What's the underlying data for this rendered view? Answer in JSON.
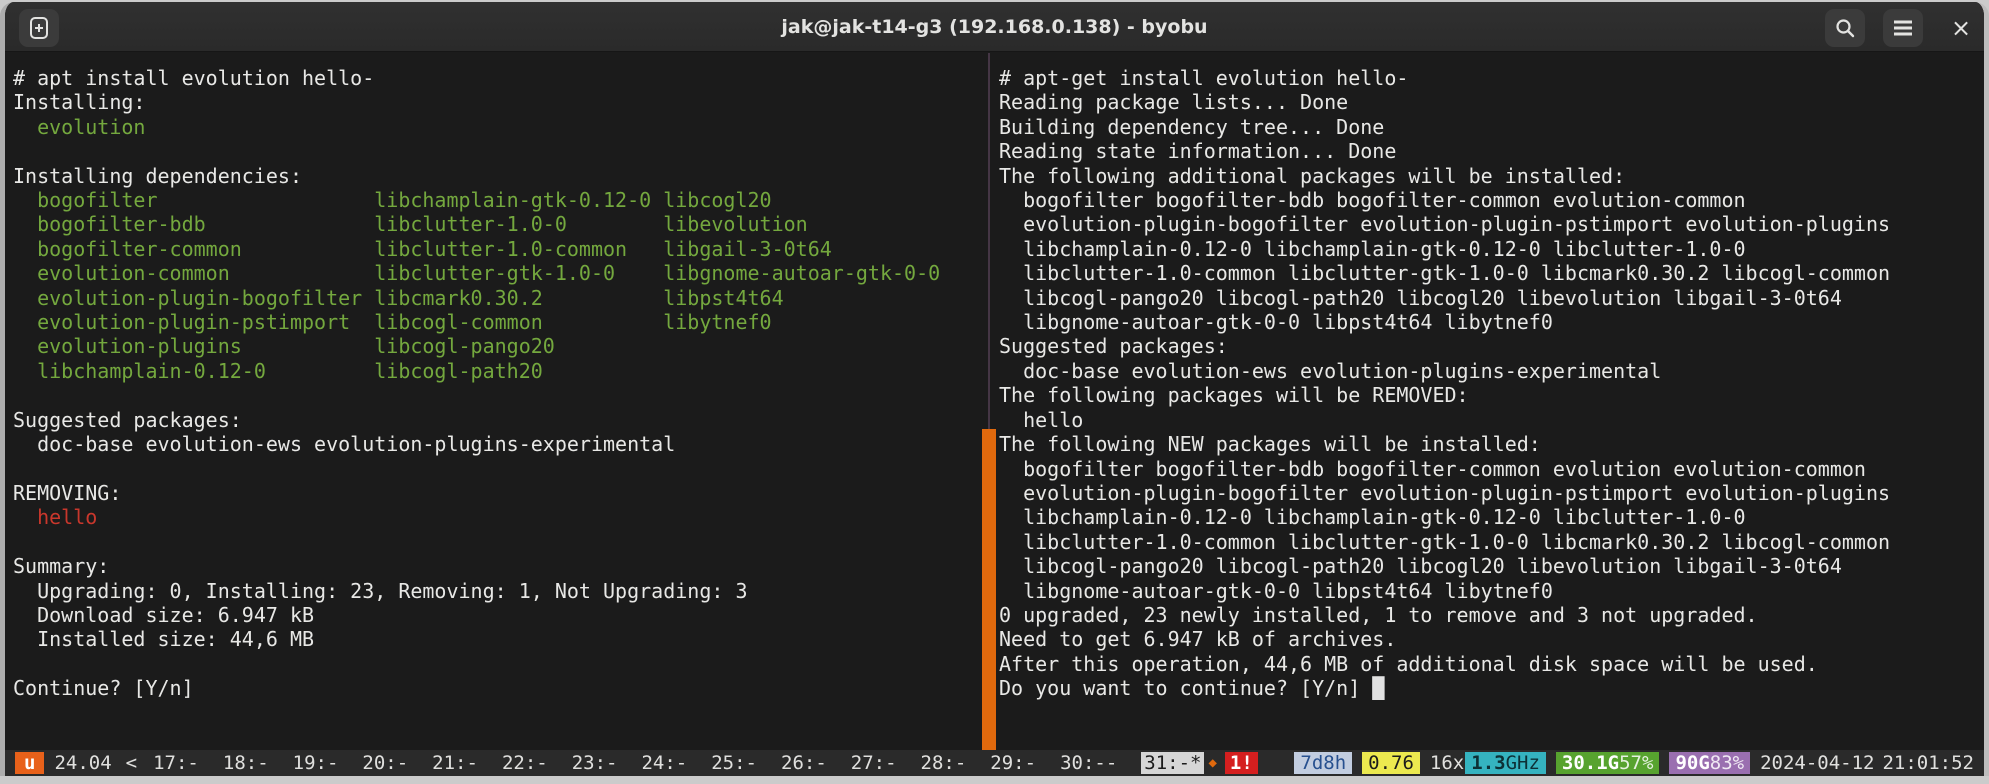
{
  "window": {
    "title": "jak@jak-t14-g3 (192.168.0.138) - byobu"
  },
  "titlebar": {
    "close_glyph": "×"
  },
  "colors": {
    "terminal_bg": "#1b1b1b",
    "titlebar_bg": "#2d2d2d",
    "statusbar_bg": "#2a2a2a",
    "text": "#e8e8e6",
    "green": "#74a83e",
    "red": "#c9372c",
    "active_pane_indicator": "#e0690d",
    "distro_badge": "#e8611a",
    "alert_badge": "#d51f1f",
    "uptime_badge": "#c2cde0",
    "load_badge": "#ece94f",
    "freq_badge": "#35b3c0",
    "mem_badge": "#57a32f",
    "disk_badge": "#9a6fb0"
  },
  "left_pane": {
    "lines": [
      [
        [
          "# apt install evolution hello-",
          "w"
        ]
      ],
      [
        [
          "Installing:",
          "w"
        ]
      ],
      [
        [
          "  ",
          "w"
        ],
        [
          "evolution",
          "g"
        ]
      ],
      [],
      [
        [
          "Installing dependencies:",
          "w"
        ]
      ],
      [
        [
          "  bogofilter                  libchamplain-gtk-0.12-0 libcogl20",
          "g"
        ]
      ],
      [
        [
          "  bogofilter-bdb              libclutter-1.0-0        libevolution",
          "g"
        ]
      ],
      [
        [
          "  bogofilter-common           libclutter-1.0-common   libgail-3-0t64",
          "g"
        ]
      ],
      [
        [
          "  evolution-common            libclutter-gtk-1.0-0    libgnome-autoar-gtk-0-0",
          "g"
        ]
      ],
      [
        [
          "  evolution-plugin-bogofilter libcmark0.30.2          libpst4t64",
          "g"
        ]
      ],
      [
        [
          "  evolution-plugin-pstimport  libcogl-common          libytnef0",
          "g"
        ]
      ],
      [
        [
          "  evolution-plugins           libcogl-pango20",
          "g"
        ]
      ],
      [
        [
          "  libchamplain-0.12-0         libcogl-path20",
          "g"
        ]
      ],
      [],
      [
        [
          "Suggested packages:",
          "w"
        ]
      ],
      [
        [
          "  doc-base evolution-ews evolution-plugins-experimental",
          "w"
        ]
      ],
      [],
      [
        [
          "REMOVING:",
          "w"
        ]
      ],
      [
        [
          "  ",
          "w"
        ],
        [
          "hello",
          "r"
        ]
      ],
      [],
      [
        [
          "Summary:",
          "w"
        ]
      ],
      [
        [
          "  Upgrading: 0, Installing: 23, Removing: 1, Not Upgrading: 3",
          "w"
        ]
      ],
      [
        [
          "  Download size: 6.947 kB",
          "w"
        ]
      ],
      [
        [
          "  Installed size: 44,6 MB",
          "w"
        ]
      ],
      [],
      [
        [
          "Continue? [Y/n]",
          "w"
        ]
      ]
    ]
  },
  "right_pane": {
    "lines": [
      [
        [
          "# apt-get install evolution hello-",
          "w"
        ]
      ],
      [
        [
          "Reading package lists... Done",
          "w"
        ]
      ],
      [
        [
          "Building dependency tree... Done",
          "w"
        ]
      ],
      [
        [
          "Reading state information... Done",
          "w"
        ]
      ],
      [
        [
          "The following additional packages will be installed:",
          "w"
        ]
      ],
      [
        [
          "  bogofilter bogofilter-bdb bogofilter-common evolution-common",
          "w"
        ]
      ],
      [
        [
          "  evolution-plugin-bogofilter evolution-plugin-pstimport evolution-plugins",
          "w"
        ]
      ],
      [
        [
          "  libchamplain-0.12-0 libchamplain-gtk-0.12-0 libclutter-1.0-0",
          "w"
        ]
      ],
      [
        [
          "  libclutter-1.0-common libclutter-gtk-1.0-0 libcmark0.30.2 libcogl-common",
          "w"
        ]
      ],
      [
        [
          "  libcogl-pango20 libcogl-path20 libcogl20 libevolution libgail-3-0t64",
          "w"
        ]
      ],
      [
        [
          "  libgnome-autoar-gtk-0-0 libpst4t64 libytnef0",
          "w"
        ]
      ],
      [
        [
          "Suggested packages:",
          "w"
        ]
      ],
      [
        [
          "  doc-base evolution-ews evolution-plugins-experimental",
          "w"
        ]
      ],
      [
        [
          "The following packages will be REMOVED:",
          "w"
        ]
      ],
      [
        [
          "  hello",
          "w"
        ]
      ],
      [
        [
          "The following NEW packages will be installed:",
          "w"
        ]
      ],
      [
        [
          "  bogofilter bogofilter-bdb bogofilter-common evolution evolution-common",
          "w"
        ]
      ],
      [
        [
          "  evolution-plugin-bogofilter evolution-plugin-pstimport evolution-plugins",
          "w"
        ]
      ],
      [
        [
          "  libchamplain-0.12-0 libchamplain-gtk-0.12-0 libclutter-1.0-0",
          "w"
        ]
      ],
      [
        [
          "  libclutter-1.0-common libclutter-gtk-1.0-0 libcmark0.30.2 libcogl-common",
          "w"
        ]
      ],
      [
        [
          "  libcogl-pango20 libcogl-path20 libcogl20 libevolution libgail-3-0t64",
          "w"
        ]
      ],
      [
        [
          "  libgnome-autoar-gtk-0-0 libpst4t64 libytnef0",
          "w"
        ]
      ],
      [
        [
          "0 upgraded, 23 newly installed, 1 to remove and 3 not upgraded.",
          "w"
        ]
      ],
      [
        [
          "Need to get 6.947 kB of archives.",
          "w"
        ]
      ],
      [
        [
          "After this operation, 44,6 MB of additional disk space will be used.",
          "w"
        ]
      ],
      [
        [
          "Do you want to continue? [Y/n] ",
          "w"
        ],
        [
          "█",
          "cursor"
        ]
      ]
    ]
  },
  "statusbar": {
    "distro_badge": "u",
    "release": "24.04",
    "arrow": "<",
    "windows": [
      "17:-",
      "18:-",
      "19:-",
      "20:-",
      "21:-",
      "22:-",
      "23:-",
      "24:-",
      "25:-",
      "26:-",
      "27:-",
      "28:-",
      "29:-",
      "30:--"
    ],
    "current_window": "31:-*",
    "flag_icon": "◆",
    "alert_badge": "1!",
    "uptime": "7d8h",
    "load": "0.76",
    "cpu_count": "16x",
    "freq_value": "1.3",
    "freq_unit": "GHz",
    "mem_value": "30.1G",
    "mem_pct": "57%",
    "disk_value": "90G",
    "disk_pct": "83%",
    "date": "2024-04-12",
    "time": "21:01:52"
  }
}
